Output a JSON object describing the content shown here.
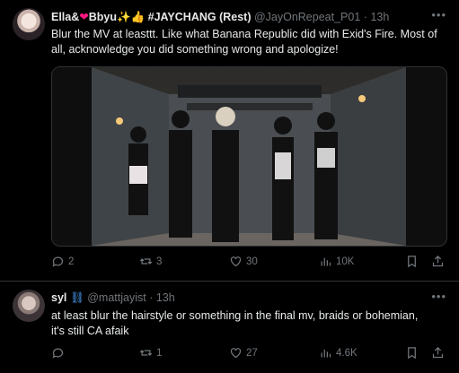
{
  "tweets": [
    {
      "author": {
        "name_part1": "Ella&",
        "name_part2": "Bbyu",
        "name_part3": "#JAYCHANG (Rest)",
        "handle": "@JayOnRepeat_P01",
        "time": "13h"
      },
      "text": "Blur the MV at leasttt. Like what Banana Republic did with Exid's Fire. Most of all, acknowledge you did something wrong and apologize!",
      "stats": {
        "replies": "2",
        "retweets": "3",
        "likes": "30",
        "views": "10K"
      }
    },
    {
      "author": {
        "name": "syl",
        "handle": "@mattjayist",
        "time": "13h"
      },
      "text_line1": "at least blur the hairstyle or something in the final mv, braids or bohemian,",
      "text_line2": "it's still CA afaik",
      "stats": {
        "replies": "",
        "retweets": "1",
        "likes": "27",
        "views": "4.6K"
      }
    }
  ],
  "colors": {
    "background": "#000000",
    "text": "#e7e9ea",
    "muted": "#71767b",
    "heart": "#f91880",
    "sparkle": "#ffd24a",
    "thumb": "#ffcc33"
  },
  "icons": [
    "reply-icon",
    "retweet-icon",
    "like-icon",
    "views-icon",
    "bookmark-icon",
    "share-icon",
    "more-icon"
  ]
}
